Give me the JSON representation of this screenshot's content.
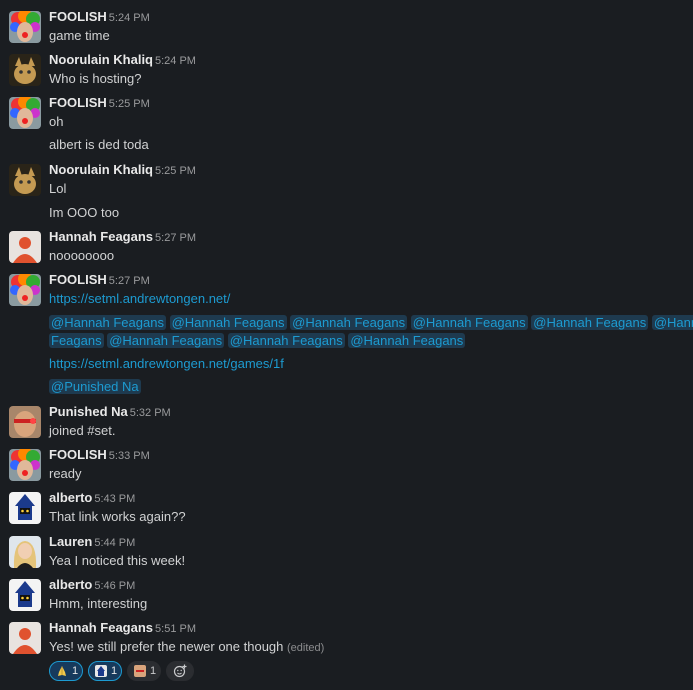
{
  "messages": [
    {
      "author": "FOOLISH",
      "time": "5:24 PM",
      "lines": [
        "game time"
      ]
    },
    {
      "author": "Noorulain Khaliq",
      "time": "5:24 PM",
      "lines": [
        "Who is hosting?"
      ]
    },
    {
      "author": "FOOLISH",
      "time": "5:25 PM",
      "lines": [
        "oh",
        "albert is ded toda"
      ]
    },
    {
      "author": "Noorulain Khaliq",
      "time": "5:25 PM",
      "lines": [
        "Lol",
        "Im OOO too"
      ]
    },
    {
      "author": "Hannah Feagans",
      "time": "5:27 PM",
      "lines": [
        "noooooooo"
      ]
    },
    {
      "author": "FOOLISH",
      "time": "5:27 PM",
      "link1": "https://setml.andrewtongen.net/",
      "mention": "@Hannah Feagans",
      "mention_part_a": "@Hannah",
      "mention_part_b": "Feagans",
      "link2": "https://setml.andrewtongen.net/games/1f",
      "mention2": "@Punished Na"
    },
    {
      "author": "Punished Na",
      "time": "5:32 PM",
      "lines": [
        "joined #set."
      ]
    },
    {
      "author": "FOOLISH",
      "time": "5:33 PM",
      "lines": [
        "ready"
      ]
    },
    {
      "author": "alberto",
      "time": "5:43 PM",
      "lines": [
        "That link works again??"
      ]
    },
    {
      "author": "Lauren",
      "time": "5:44 PM",
      "lines": [
        "Yea I noticed this week!"
      ]
    },
    {
      "author": "alberto",
      "time": "5:46 PM",
      "lines": [
        "Hmm, interesting"
      ]
    },
    {
      "author": "Hannah Feagans",
      "time": "5:51 PM",
      "lines": [
        "Yes! we still prefer the newer one though"
      ],
      "edited": "(edited)"
    }
  ],
  "reactions": [
    {
      "icon": "pray-icon",
      "count": "1"
    },
    {
      "icon": "custom-emoji-icon",
      "count": "1"
    },
    {
      "icon": "avatar-emoji-icon",
      "count": "1"
    }
  ],
  "colors": {
    "background": "#1a1d21",
    "link": "#1d9bd1",
    "mention_bg": "#1e3a4f"
  }
}
